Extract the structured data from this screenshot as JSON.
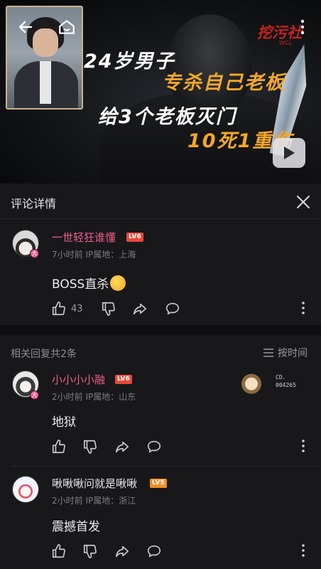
{
  "video": {
    "headline_lines": [
      "24岁男子",
      "专杀自己老板",
      "给3个老板灭门",
      "10死1重伤"
    ],
    "brand_text": "挖污社",
    "brand_sub": "WGL",
    "accent_color": "#f3a72b"
  },
  "panel": {
    "title": "评论详情"
  },
  "main_comment": {
    "username": "一世轻狂谁懂",
    "level": "LV6",
    "name_color": "#f05c8c",
    "avatar_badge": "大",
    "time": "7小时前",
    "location": "IP属地：上海",
    "text": "BOSS直杀",
    "likes": "43"
  },
  "replies_header": {
    "count_label": "相关回复共2条",
    "sort_label": "按时间"
  },
  "replies": [
    {
      "username": "小小小小融",
      "level": "LV6",
      "name_color": "#f05c8c",
      "avatar_badge": "大",
      "time": "2小时前",
      "location": "IP属地：山东",
      "text": "地狱",
      "decoration_code_1": "CD.",
      "decoration_code_2": "004265"
    },
    {
      "username": "啾啾啾问就是啾啾",
      "level": "LV5",
      "name_color": "#e8e8ea",
      "time": "2小时前",
      "location": "IP属地：浙江",
      "text": "震撼首发"
    }
  ],
  "icons": [
    "back-arrow-icon",
    "home-icon",
    "more-vertical-icon",
    "play-icon",
    "close-icon",
    "thumbs-up-icon",
    "thumbs-down-icon",
    "share-icon",
    "reply-bubble-icon",
    "sort-lines-icon"
  ]
}
